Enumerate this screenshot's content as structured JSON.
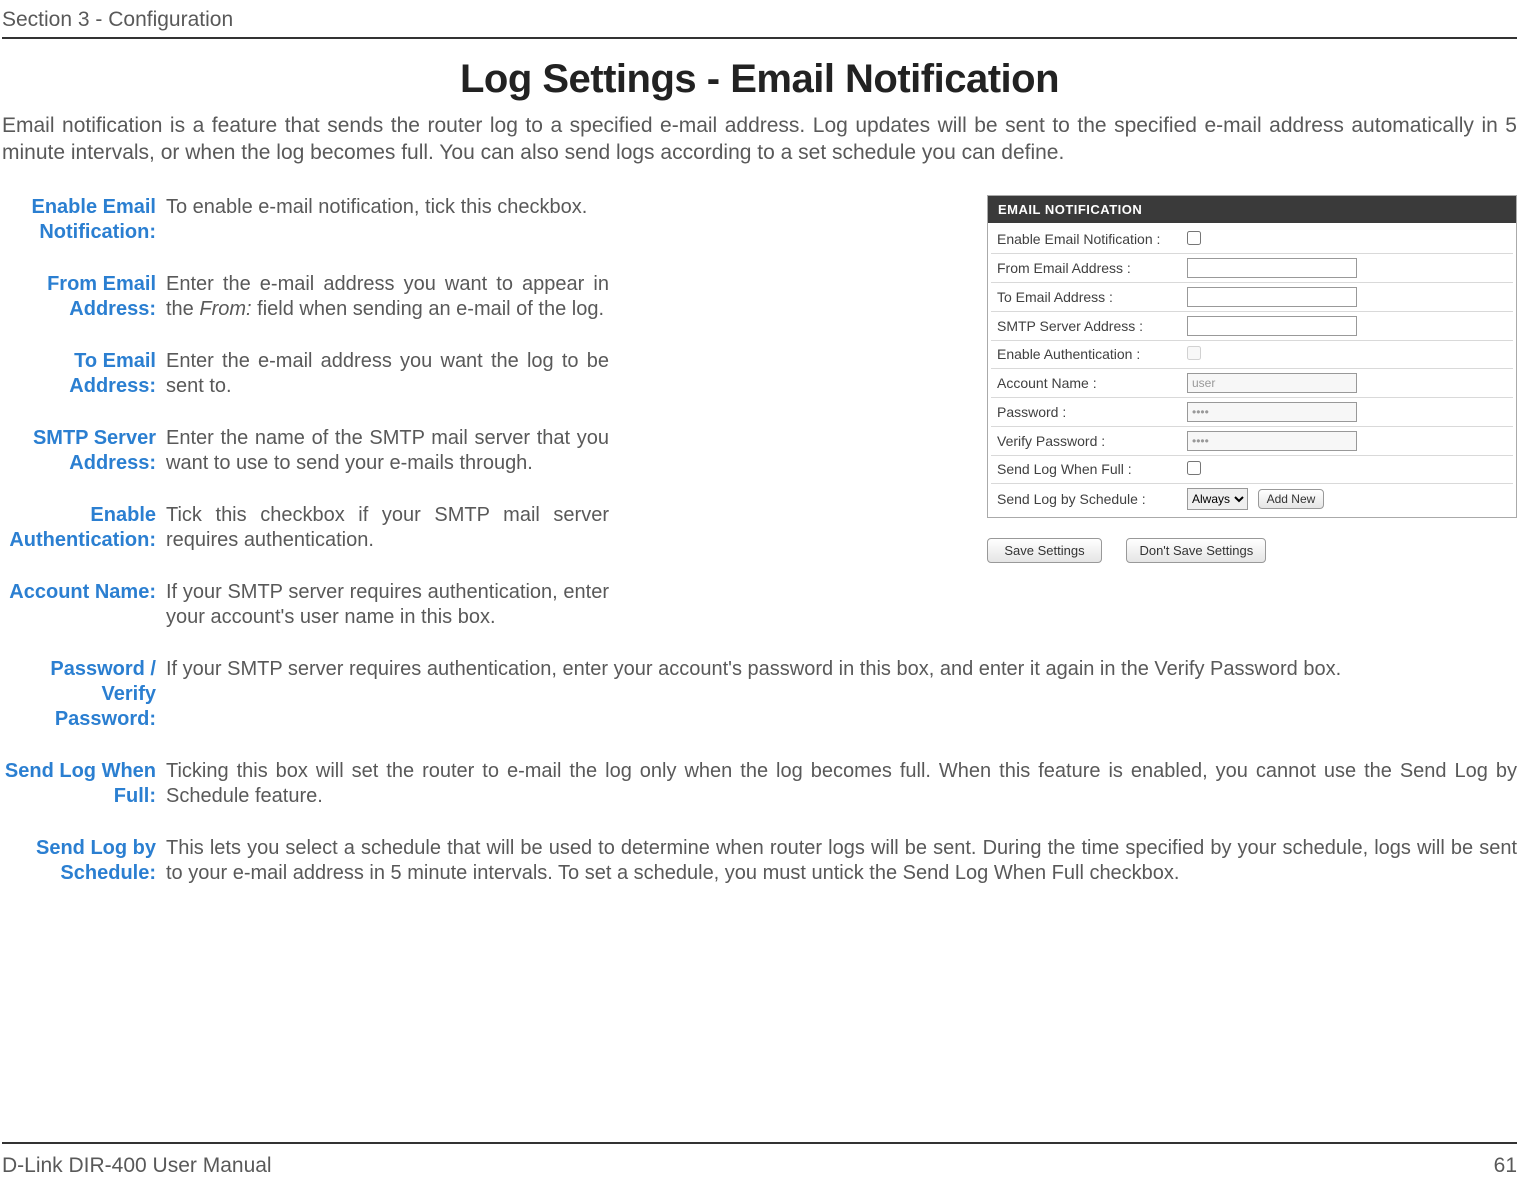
{
  "header": {
    "section": "Section 3 - Configuration"
  },
  "title": "Log Settings - Email Notification",
  "intro": "Email notification is a feature that sends the router log to a specified e-mail address. Log updates will be sent to the specified e-mail address automatically in 5 minute intervals, or when the log becomes full.  You can also send logs according to a set schedule you can define.",
  "defs": {
    "enable_email_label": "Enable Email Notification:",
    "enable_email_value": "To enable e-mail notification, tick this checkbox.",
    "from_email_label": "From Email Address:",
    "from_email_value_pre": "Enter the e-mail address you want to appear in the ",
    "from_email_value_em": "From:",
    "from_email_value_post": " field when sending an e-mail of the log.",
    "to_email_label": "To Email Address:",
    "to_email_value": "Enter the e-mail address you want the log to be sent to.",
    "smtp_label": "SMTP Server Address:",
    "smtp_value": "Enter the name of the SMTP mail server that you want to use to send your e-mails through.",
    "enable_auth_label": "Enable Authentication:",
    "enable_auth_value": "Tick this checkbox if your SMTP mail server requires authentication.",
    "account_label": "Account Name:",
    "account_value": "If your SMTP server requires authentication, enter your account's user name in this box.",
    "password_label": "Password / Verify Password:",
    "password_value": "If your SMTP server requires authentication, enter your account's password in this box, and enter it again in the Verify Password box.",
    "sendfull_label": "Send Log When Full:",
    "sendfull_value": "Ticking this box will set the router to e-mail the log only when the log becomes full. When this feature is enabled, you cannot use the Send Log by Schedule feature.",
    "sendsched_label": "Send Log by Schedule:",
    "sendsched_value": "This lets you select a schedule that will be used to determine when router logs will be sent. During the time specified by your schedule, logs will be sent to your e-mail address in 5 minute intervals. To set a schedule, you must untick the Send Log When Full checkbox."
  },
  "panel": {
    "title": "EMAIL NOTIFICATION",
    "rows": {
      "enable_email": "Enable Email Notification :",
      "from_email": "From Email Address :",
      "to_email": "To Email Address :",
      "smtp": "SMTP Server Address :",
      "enable_auth": "Enable Authentication :",
      "account": "Account Name :",
      "account_value": "user",
      "password": "Password :",
      "password_value": "••••",
      "verify": "Verify Password :",
      "verify_value": "••••",
      "sendfull": "Send Log When Full :",
      "sendsched": "Send Log by Schedule :",
      "schedule_option": "Always",
      "add_new": "Add New"
    },
    "buttons": {
      "save": "Save Settings",
      "dont_save": "Don't Save Settings"
    }
  },
  "footer": {
    "left": "D-Link DIR-400 User Manual",
    "right": "61"
  }
}
